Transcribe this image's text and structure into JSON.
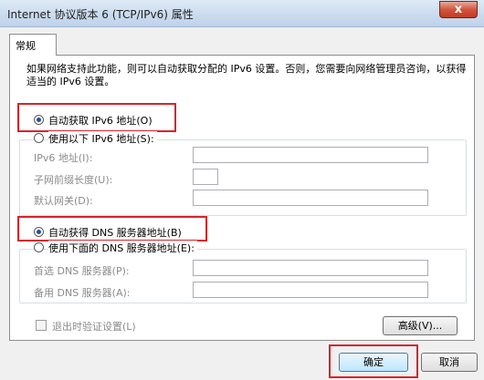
{
  "window": {
    "title": "Internet 协议版本 6 (TCP/IPv6) 属性",
    "close_label": "x"
  },
  "tabs": [
    {
      "label": "常规"
    }
  ],
  "description": "如果网络支持此功能，则可以自动获取分配的 IPv6 设置。否则，您需要向网络管理员咨询，以获得适当的 IPv6 设置。",
  "ip_section": {
    "auto_label": "自动获取 IPv6 地址(O)",
    "auto_selected": true,
    "manual_label": "使用以下 IPv6 地址(S):",
    "fields": [
      {
        "label": "IPv6 地址(I):",
        "value": ""
      },
      {
        "label": "子网前缀长度(U):",
        "value": ""
      },
      {
        "label": "默认网关(D):",
        "value": ""
      }
    ]
  },
  "dns_section": {
    "auto_label": "自动获得 DNS 服务器地址(B)",
    "auto_selected": true,
    "manual_label": "使用下面的 DNS 服务器地址(E):",
    "fields": [
      {
        "label": "首选 DNS 服务器(P):",
        "value": ""
      },
      {
        "label": "备用 DNS 服务器(A):",
        "value": ""
      }
    ]
  },
  "validate_checkbox": {
    "label": "退出时验证设置(L)",
    "checked": false
  },
  "buttons": {
    "advanced": "高级(V)...",
    "ok": "确定",
    "cancel": "取消"
  },
  "colors": {
    "highlight_border": "#d8232a",
    "radio_dot": "#1e4fa7"
  }
}
